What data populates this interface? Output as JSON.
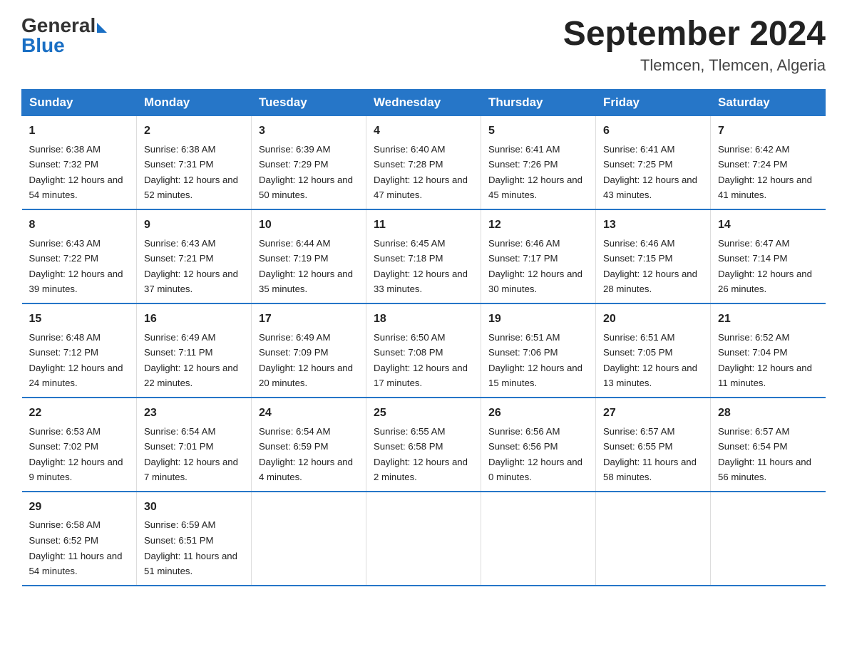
{
  "header": {
    "logo_general": "General",
    "logo_blue": "Blue",
    "month_year": "September 2024",
    "location": "Tlemcen, Tlemcen, Algeria"
  },
  "days_of_week": [
    "Sunday",
    "Monday",
    "Tuesday",
    "Wednesday",
    "Thursday",
    "Friday",
    "Saturday"
  ],
  "weeks": [
    [
      {
        "day": "1",
        "sunrise": "6:38 AM",
        "sunset": "7:32 PM",
        "daylight": "12 hours and 54 minutes."
      },
      {
        "day": "2",
        "sunrise": "6:38 AM",
        "sunset": "7:31 PM",
        "daylight": "12 hours and 52 minutes."
      },
      {
        "day": "3",
        "sunrise": "6:39 AM",
        "sunset": "7:29 PM",
        "daylight": "12 hours and 50 minutes."
      },
      {
        "day": "4",
        "sunrise": "6:40 AM",
        "sunset": "7:28 PM",
        "daylight": "12 hours and 47 minutes."
      },
      {
        "day": "5",
        "sunrise": "6:41 AM",
        "sunset": "7:26 PM",
        "daylight": "12 hours and 45 minutes."
      },
      {
        "day": "6",
        "sunrise": "6:41 AM",
        "sunset": "7:25 PM",
        "daylight": "12 hours and 43 minutes."
      },
      {
        "day": "7",
        "sunrise": "6:42 AM",
        "sunset": "7:24 PM",
        "daylight": "12 hours and 41 minutes."
      }
    ],
    [
      {
        "day": "8",
        "sunrise": "6:43 AM",
        "sunset": "7:22 PM",
        "daylight": "12 hours and 39 minutes."
      },
      {
        "day": "9",
        "sunrise": "6:43 AM",
        "sunset": "7:21 PM",
        "daylight": "12 hours and 37 minutes."
      },
      {
        "day": "10",
        "sunrise": "6:44 AM",
        "sunset": "7:19 PM",
        "daylight": "12 hours and 35 minutes."
      },
      {
        "day": "11",
        "sunrise": "6:45 AM",
        "sunset": "7:18 PM",
        "daylight": "12 hours and 33 minutes."
      },
      {
        "day": "12",
        "sunrise": "6:46 AM",
        "sunset": "7:17 PM",
        "daylight": "12 hours and 30 minutes."
      },
      {
        "day": "13",
        "sunrise": "6:46 AM",
        "sunset": "7:15 PM",
        "daylight": "12 hours and 28 minutes."
      },
      {
        "day": "14",
        "sunrise": "6:47 AM",
        "sunset": "7:14 PM",
        "daylight": "12 hours and 26 minutes."
      }
    ],
    [
      {
        "day": "15",
        "sunrise": "6:48 AM",
        "sunset": "7:12 PM",
        "daylight": "12 hours and 24 minutes."
      },
      {
        "day": "16",
        "sunrise": "6:49 AM",
        "sunset": "7:11 PM",
        "daylight": "12 hours and 22 minutes."
      },
      {
        "day": "17",
        "sunrise": "6:49 AM",
        "sunset": "7:09 PM",
        "daylight": "12 hours and 20 minutes."
      },
      {
        "day": "18",
        "sunrise": "6:50 AM",
        "sunset": "7:08 PM",
        "daylight": "12 hours and 17 minutes."
      },
      {
        "day": "19",
        "sunrise": "6:51 AM",
        "sunset": "7:06 PM",
        "daylight": "12 hours and 15 minutes."
      },
      {
        "day": "20",
        "sunrise": "6:51 AM",
        "sunset": "7:05 PM",
        "daylight": "12 hours and 13 minutes."
      },
      {
        "day": "21",
        "sunrise": "6:52 AM",
        "sunset": "7:04 PM",
        "daylight": "12 hours and 11 minutes."
      }
    ],
    [
      {
        "day": "22",
        "sunrise": "6:53 AM",
        "sunset": "7:02 PM",
        "daylight": "12 hours and 9 minutes."
      },
      {
        "day": "23",
        "sunrise": "6:54 AM",
        "sunset": "7:01 PM",
        "daylight": "12 hours and 7 minutes."
      },
      {
        "day": "24",
        "sunrise": "6:54 AM",
        "sunset": "6:59 PM",
        "daylight": "12 hours and 4 minutes."
      },
      {
        "day": "25",
        "sunrise": "6:55 AM",
        "sunset": "6:58 PM",
        "daylight": "12 hours and 2 minutes."
      },
      {
        "day": "26",
        "sunrise": "6:56 AM",
        "sunset": "6:56 PM",
        "daylight": "12 hours and 0 minutes."
      },
      {
        "day": "27",
        "sunrise": "6:57 AM",
        "sunset": "6:55 PM",
        "daylight": "11 hours and 58 minutes."
      },
      {
        "day": "28",
        "sunrise": "6:57 AM",
        "sunset": "6:54 PM",
        "daylight": "11 hours and 56 minutes."
      }
    ],
    [
      {
        "day": "29",
        "sunrise": "6:58 AM",
        "sunset": "6:52 PM",
        "daylight": "11 hours and 54 minutes."
      },
      {
        "day": "30",
        "sunrise": "6:59 AM",
        "sunset": "6:51 PM",
        "daylight": "11 hours and 51 minutes."
      },
      null,
      null,
      null,
      null,
      null
    ]
  ]
}
